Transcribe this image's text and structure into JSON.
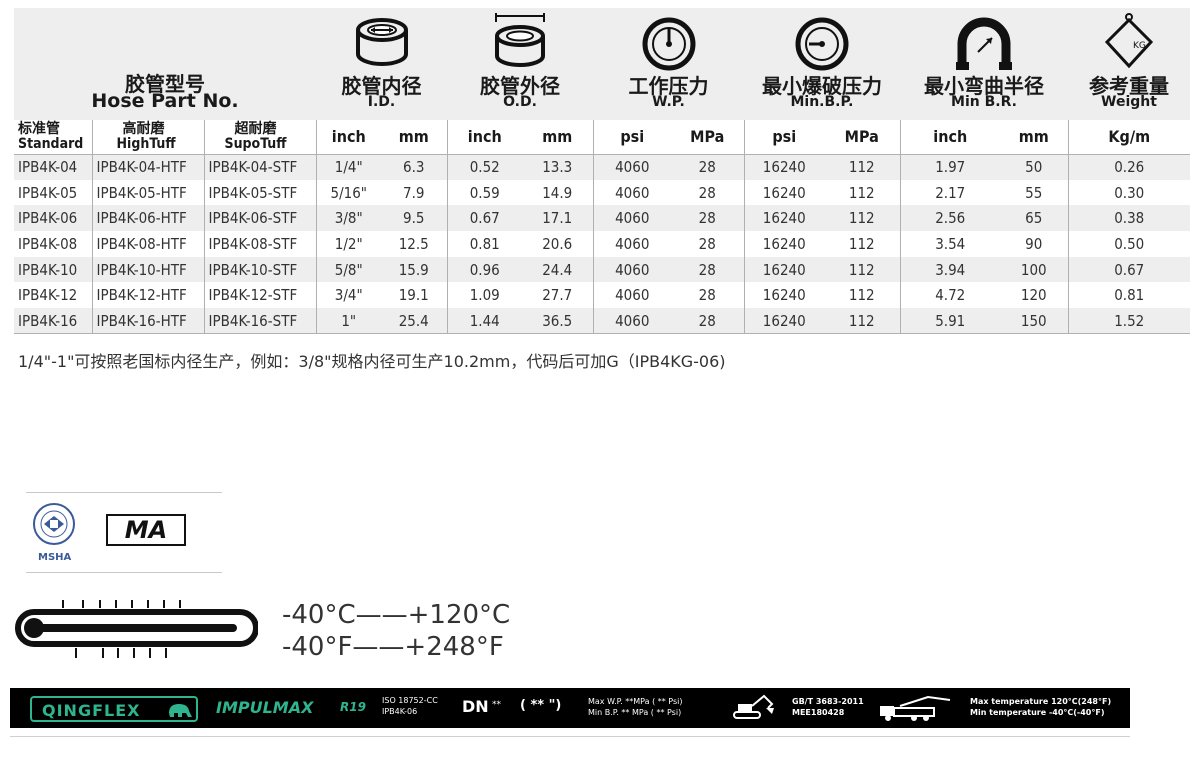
{
  "header": {
    "part": {
      "zh": "胶管型号",
      "en": "Hose Part No."
    },
    "id": {
      "zh": "胶管内径",
      "en": "I.D."
    },
    "od": {
      "zh": "胶管外径",
      "en": "O.D."
    },
    "wp": {
      "zh": "工作压力",
      "en": "W.P."
    },
    "bp": {
      "zh": "最小爆破压力",
      "en": "Min.B.P."
    },
    "br": {
      "zh": "最小弯曲半径",
      "en": "Min B.R."
    },
    "wt": {
      "zh": "参考重量",
      "en": "Weight"
    }
  },
  "subheader": {
    "standard_zh": "标准管",
    "standard_en": "Standard",
    "hightuff_zh": "高耐磨",
    "hightuff_en": "HighTuff",
    "supotuff_zh": "超耐磨",
    "supotuff_en": "SupoTuff",
    "inch": "inch",
    "mm": "mm",
    "psi": "psi",
    "mpa": "MPa",
    "kgm": "Kg/m"
  },
  "rows": [
    [
      "IPB4K-04",
      "IPB4K-04-HTF",
      "IPB4K-04-STF",
      "1/4\"",
      "6.3",
      "0.52",
      "13.3",
      "4060",
      "28",
      "16240",
      "112",
      "1.97",
      "50",
      "0.26"
    ],
    [
      "IPB4K-05",
      "IPB4K-05-HTF",
      "IPB4K-05-STF",
      "5/16\"",
      "7.9",
      "0.59",
      "14.9",
      "4060",
      "28",
      "16240",
      "112",
      "2.17",
      "55",
      "0.30"
    ],
    [
      "IPB4K-06",
      "IPB4K-06-HTF",
      "IPB4K-06-STF",
      "3/8\"",
      "9.5",
      "0.67",
      "17.1",
      "4060",
      "28",
      "16240",
      "112",
      "2.56",
      "65",
      "0.38"
    ],
    [
      "IPB4K-08",
      "IPB4K-08-HTF",
      "IPB4K-08-STF",
      "1/2\"",
      "12.5",
      "0.81",
      "20.6",
      "4060",
      "28",
      "16240",
      "112",
      "3.54",
      "90",
      "0.50"
    ],
    [
      "IPB4K-10",
      "IPB4K-10-HTF",
      "IPB4K-10-STF",
      "5/8\"",
      "15.9",
      "0.96",
      "24.4",
      "4060",
      "28",
      "16240",
      "112",
      "3.94",
      "100",
      "0.67"
    ],
    [
      "IPB4K-12",
      "IPB4K-12-HTF",
      "IPB4K-12-STF",
      "3/4\"",
      "19.1",
      "1.09",
      "27.7",
      "4060",
      "28",
      "16240",
      "112",
      "4.72",
      "120",
      "0.81"
    ],
    [
      "IPB4K-16",
      "IPB4K-16-HTF",
      "IPB4K-16-STF",
      "1\"",
      "25.4",
      "1.44",
      "36.5",
      "4060",
      "28",
      "16240",
      "112",
      "5.91",
      "150",
      "1.52"
    ]
  ],
  "note": "1/4\"-1\"可按照老国标内径生产，例如：3/8\"规格内径可生产10.2mm，代码后可加G（IPB4KG-06)",
  "certs": {
    "msha_label": "MSHA",
    "ma_label": "MA"
  },
  "temperature": {
    "celsius": "-40°C——+120°C",
    "fahrenheit": "-40°F——+248°F"
  },
  "brand": {
    "logo": "QINGFLEX",
    "product": "IMPULMAX",
    "r19": "R19",
    "iso1": "ISO 18752-CC",
    "iso2": "IPB4K-06",
    "dn": "DN",
    "stars": "**",
    "inch_paren": "( ** \")",
    "maxwp": "Max W.P. **MPa ( ** Psi)",
    "minbp": "Min B.P. ** MPa ( ** Psi)",
    "gbt": "GB/T 3683-2011",
    "mee": "MEE180428",
    "maxtemp": "Max temperature 120°C(248°F)",
    "mintemp": "Min temperature -40°C(-40°F)"
  },
  "colors": {
    "band_gray": "#eeeeee",
    "brand_green": "#2fb58e",
    "text": "#333333"
  }
}
